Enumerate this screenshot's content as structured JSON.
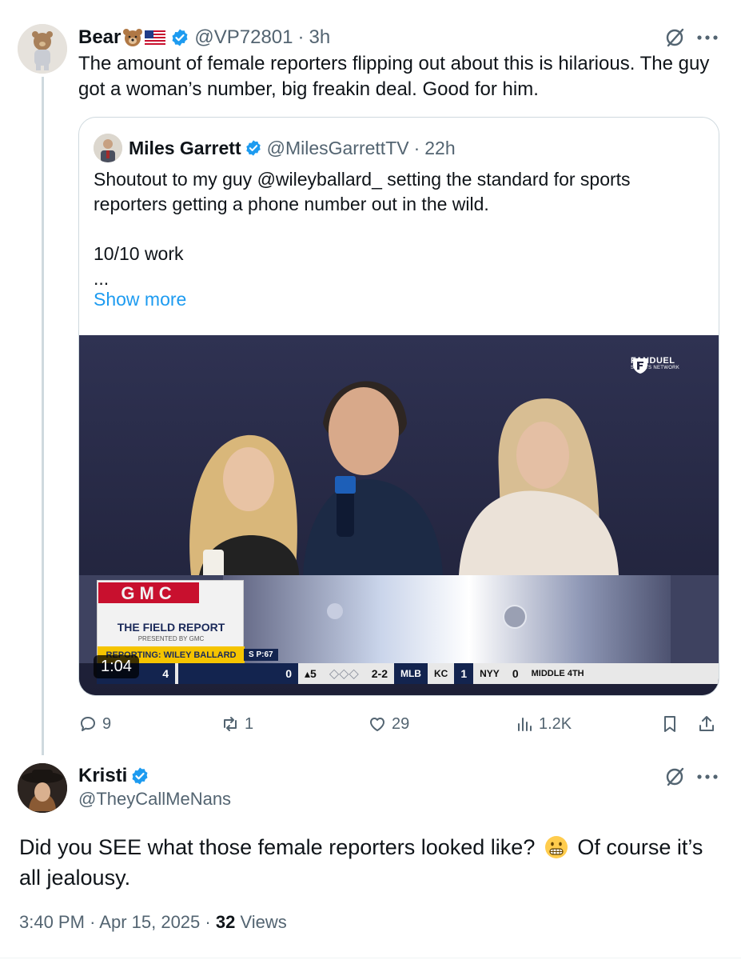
{
  "main_post": {
    "display_name": "Bear",
    "handle": "@VP72801",
    "time": "3h",
    "separator": "·",
    "text": "The amount of female reporters flipping out about this is hilarious. The guy got a woman’s number, big freakin deal. Good for him."
  },
  "quoted_post": {
    "display_name": "Miles Garrett",
    "handle": "@MilesGarrettTV",
    "time": "22h",
    "separator": "·",
    "text": "Shoutout to my guy @wileyballard_ setting the standard for sports reporters getting a phone number out in the wild.\n\n10/10 work\n...",
    "show_more": "Show more",
    "video": {
      "duration": "1:04",
      "brand_name": "FANDUEL",
      "brand_sub": "SPORTS NETWORK",
      "gmc": "GMC",
      "field_report": "THE FIELD REPORT",
      "presented_by": "PRESENTED BY GMC",
      "reporting": "REPORTING: WILEY BALLARD",
      "scorebug": {
        "away_score": "4",
        "home_score": "0",
        "pitch_tag": "S P:67",
        "outs": "5",
        "count": "2-2",
        "league": "MLB",
        "team1": "KC",
        "team1_score": "1",
        "team2": "NYY",
        "team2_score": "0",
        "inning": "MIDDLE 4TH"
      }
    }
  },
  "actions": {
    "replies": "9",
    "reposts": "1",
    "likes": "29",
    "views": "1.2K"
  },
  "reply": {
    "display_name": "Kristi",
    "handle": "@TheyCallMeNans",
    "text_before": "Did you SEE what those female reporters looked like?",
    "text_after": "Of course it’s all jealousy.",
    "time": "3:40 PM",
    "date": "Apr 15, 2025",
    "separator": "·",
    "views_count": "32",
    "views_label": "Views"
  },
  "colors": {
    "accent": "#1d9bf0",
    "verified": "#1d9bf0",
    "muted_text": "#536471",
    "border": "#cfd9de",
    "video_bg": "#2b2d48"
  },
  "icons": [
    "grok-icon",
    "more-icon",
    "verified-badge-icon",
    "reply-icon",
    "repost-icon",
    "like-icon",
    "views-icon",
    "bookmark-icon",
    "share-icon"
  ]
}
